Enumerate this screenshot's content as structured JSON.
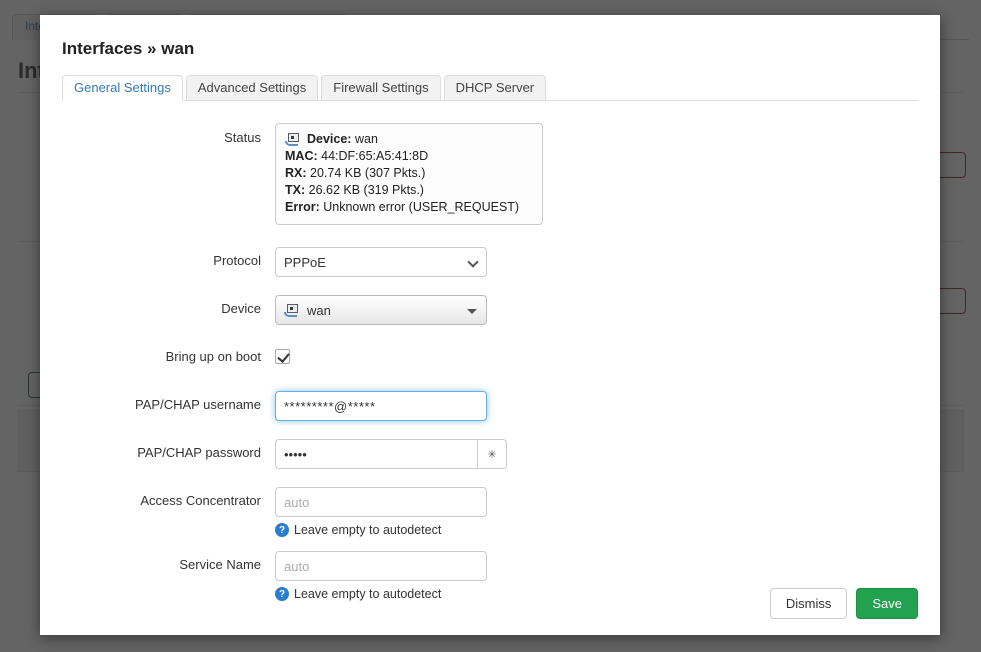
{
  "background": {
    "tabs": [
      "Interfaces",
      "",
      ""
    ],
    "heading": "Interfaces"
  },
  "modal": {
    "title": "Interfaces » wan",
    "tabs": [
      {
        "label": "General Settings",
        "active": true
      },
      {
        "label": "Advanced Settings",
        "active": false
      },
      {
        "label": "Firewall Settings",
        "active": false
      },
      {
        "label": "DHCP Server",
        "active": false
      }
    ],
    "status": {
      "label": "Status",
      "icon": "network-interface-icon",
      "lines": [
        {
          "key": "Device:",
          "value": "wan"
        },
        {
          "key": "MAC:",
          "value": "44:DF:65:A5:41:8D"
        },
        {
          "key": "RX:",
          "value": "20.74 KB (307 Pkts.)"
        },
        {
          "key": "TX:",
          "value": "26.62 KB (319 Pkts.)"
        },
        {
          "key": "Error:",
          "value": "Unknown error (USER_REQUEST)"
        }
      ]
    },
    "protocol": {
      "label": "Protocol",
      "value": "PPPoE",
      "options": [
        "PPPoE"
      ]
    },
    "device": {
      "label": "Device",
      "value": "wan",
      "icon": "network-interface-icon"
    },
    "bring_up_on_boot": {
      "label": "Bring up on boot",
      "checked": true
    },
    "username": {
      "label": "PAP/CHAP username",
      "value": "*********@*****",
      "focused": true
    },
    "password": {
      "label": "PAP/CHAP password",
      "value": "•••••",
      "reveal_glyph": "✳"
    },
    "access_concentrator": {
      "label": "Access Concentrator",
      "value": "",
      "placeholder": "auto",
      "hint": "Leave empty to autodetect",
      "hint_icon": "?"
    },
    "service_name": {
      "label": "Service Name",
      "value": "",
      "placeholder": "auto",
      "hint": "Leave empty to autodetect",
      "hint_icon": "?"
    },
    "footer": {
      "dismiss_label": "Dismiss",
      "save_label": "Save"
    }
  },
  "colors": {
    "accent_link": "#337ab7",
    "save_green": "#22a14e",
    "focus_blue": "#66afe9",
    "hint_blue": "#2b7dd1"
  }
}
